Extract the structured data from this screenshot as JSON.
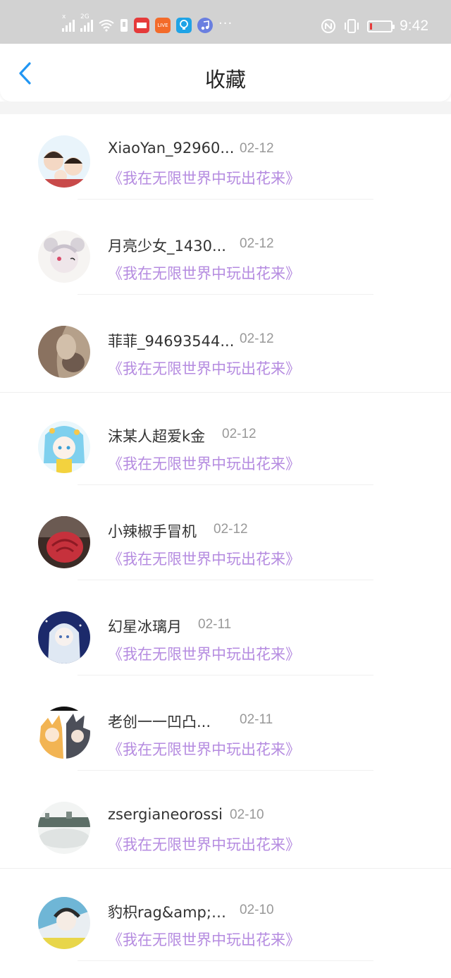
{
  "status": {
    "signal1_label": "x",
    "signal2_label": "2G",
    "app_icons": [
      "news-app-icon",
      "live-app-icon",
      "bulb-app-icon",
      "music-app-icon"
    ],
    "live_badge": "LIVE",
    "more": "···",
    "time": "9:42"
  },
  "nav": {
    "title": "收藏",
    "back_icon": "chevron-left-icon",
    "accent": "#2196f3"
  },
  "colors": {
    "book_title": "#b58be0",
    "date": "#999999",
    "name": "#333333"
  },
  "items": [
    {
      "name": "XiaoYan_92960...",
      "date": "02-12",
      "book": "《我在无限世界中玩出花来》"
    },
    {
      "name": "月亮少女_1430...",
      "date": "02-12",
      "book": "《我在无限世界中玩出花来》"
    },
    {
      "name": "菲菲_94693544...",
      "date": "02-12",
      "book": "《我在无限世界中玩出花来》"
    },
    {
      "name": "沫某人超爱k金",
      "date": "02-12",
      "book": "《我在无限世界中玩出花来》"
    },
    {
      "name": "小辣椒手冒机",
      "date": "02-12",
      "book": "《我在无限世界中玩出花来》"
    },
    {
      "name": "幻星冰璃月",
      "date": "02-11",
      "book": "《我在无限世界中玩出花来》"
    },
    {
      "name": "老创一一凹凸...",
      "date": "02-11",
      "book": "《我在无限世界中玩出花来》"
    },
    {
      "name": "zsergianeorossi",
      "date": "02-10",
      "book": "《我在无限世界中玩出花来》"
    },
    {
      "name": "豹枳rag&amp;b...",
      "date": "02-10",
      "book": "《我在无限世界中玩出花来》"
    }
  ]
}
